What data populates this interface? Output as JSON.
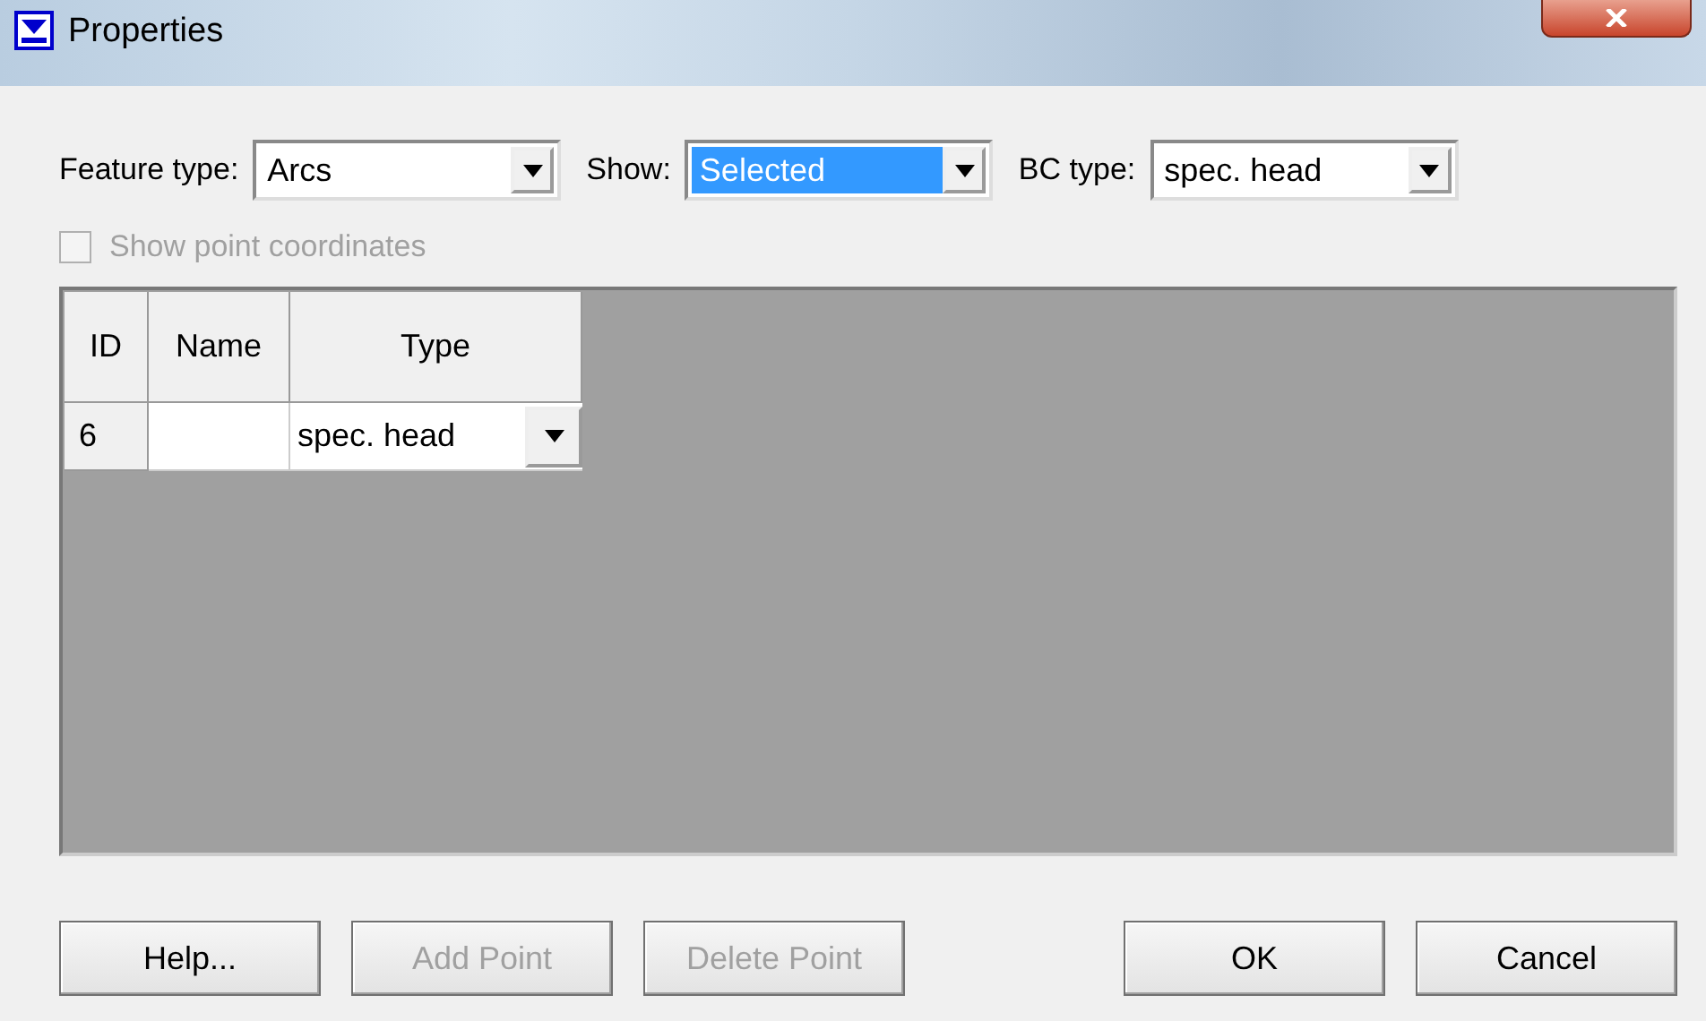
{
  "window": {
    "title": "Properties"
  },
  "filters": [
    {
      "label": "Feature type:",
      "value": "Arcs",
      "highlighted": false
    },
    {
      "label": "Show:",
      "value": "Selected",
      "highlighted": true
    },
    {
      "label": "BC type:",
      "value": "spec. head",
      "highlighted": false
    }
  ],
  "show_point_coordinates": {
    "label": "Show point coordinates",
    "checked": false,
    "disabled": true
  },
  "table": {
    "columns": [
      "ID",
      "Name",
      "Type"
    ],
    "rows": [
      {
        "id": "6",
        "name": "",
        "type": "spec. head"
      }
    ]
  },
  "buttons": [
    {
      "label": "Help...",
      "disabled": false
    },
    {
      "label": "Add Point",
      "disabled": true
    },
    {
      "label": "Delete Point",
      "disabled": true
    },
    {
      "label": "OK",
      "disabled": false
    },
    {
      "label": "Cancel",
      "disabled": false
    }
  ]
}
